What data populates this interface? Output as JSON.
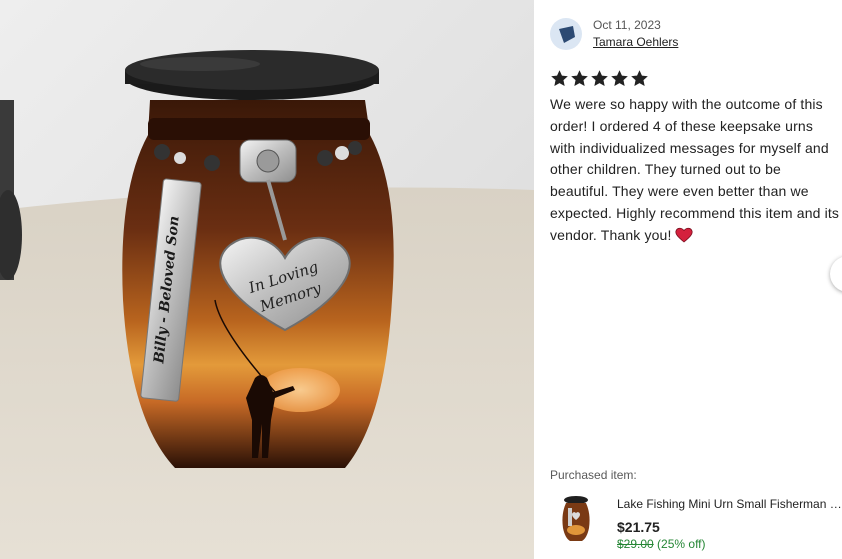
{
  "photo": {
    "alt_icon": "keepsake-urn-photo",
    "engraved_tag": "Billy - Beloved Son",
    "charm_line1": "In Loving",
    "charm_line2": "Memory"
  },
  "review": {
    "date": "Oct 11, 2023",
    "reviewer": "Tamara Oehlers",
    "rating": 5,
    "rating_max": 5,
    "text": "We were so happy with the outcome of this order! I ordered 4 of these keepsake urns with individualized messages for myself and other children. They turned out to be beautiful. They were even better than we expected. Highly recommend this item and its vendor. Thank you!",
    "emoji_icon": "red-heart-icon"
  },
  "purchased": {
    "label": "Purchased item:",
    "title": "Lake Fishing Mini Urn Small Fisherman Keepsake Urn",
    "price": "$21.75",
    "original_price": "$29.00",
    "discount": "(25% off)"
  },
  "colors": {
    "star": "#222222",
    "heart": "#d4213d",
    "sale_green": "#258635",
    "avatar_bg": "#dbe6f3",
    "avatar_fg": "#2c4a73"
  }
}
